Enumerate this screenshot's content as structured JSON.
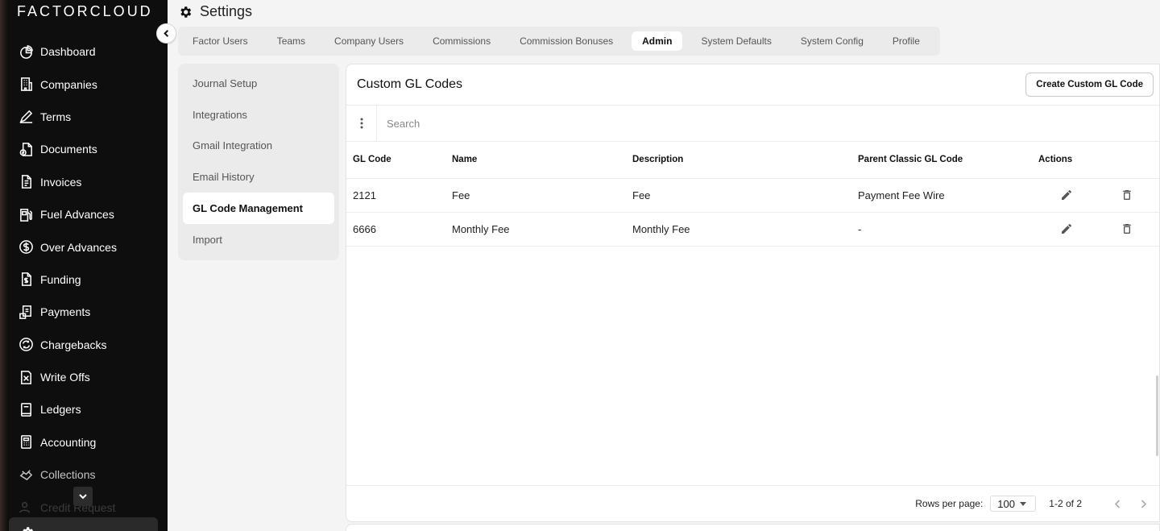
{
  "brand": "FACTORCLOUD",
  "sidebar": {
    "items": [
      {
        "label": "Dashboard",
        "icon": "dashboard-icon"
      },
      {
        "label": "Companies",
        "icon": "building-icon"
      },
      {
        "label": "Terms",
        "icon": "signature-icon"
      },
      {
        "label": "Documents",
        "icon": "documents-icon"
      },
      {
        "label": "Invoices",
        "icon": "invoice-icon"
      },
      {
        "label": "Fuel Advances",
        "icon": "fuel-icon"
      },
      {
        "label": "Over Advances",
        "icon": "dollar-icon"
      },
      {
        "label": "Funding",
        "icon": "funding-icon"
      },
      {
        "label": "Payments",
        "icon": "payments-icon"
      },
      {
        "label": "Chargebacks",
        "icon": "chargeback-icon"
      },
      {
        "label": "Write Offs",
        "icon": "write-off-icon"
      },
      {
        "label": "Ledgers",
        "icon": "ledger-icon"
      },
      {
        "label": "Accounting",
        "icon": "calculator-icon"
      },
      {
        "label": "Collections",
        "icon": "collections-icon"
      },
      {
        "label": "Credit Request",
        "icon": "credit-icon"
      }
    ]
  },
  "header": {
    "title": "Settings",
    "tabs": [
      "Factor Users",
      "Teams",
      "Company Users",
      "Commissions",
      "Commission Bonuses",
      "Admin",
      "System Defaults",
      "System Config",
      "Profile"
    ],
    "active_tab": "Admin"
  },
  "subnav": {
    "items": [
      "Journal Setup",
      "Integrations",
      "Gmail Integration",
      "Email History",
      "GL Code Management",
      "Import"
    ],
    "active": "GL Code Management"
  },
  "card": {
    "title": "Custom GL Codes",
    "create_label": "Create Custom GL Code",
    "search_placeholder": "Search",
    "columns": [
      "GL Code",
      "Name",
      "Description",
      "Parent Classic GL Code",
      "Actions"
    ],
    "rows": [
      {
        "code": "2121",
        "name": "Fee",
        "description": "Fee",
        "parent": "Payment Fee Wire"
      },
      {
        "code": "6666",
        "name": "Monthly Fee",
        "description": "Monthly Fee",
        "parent": "-"
      }
    ],
    "footer": {
      "rows_per_page_label": "Rows per page:",
      "rows_per_page_value": "100",
      "range": "1-2 of 2"
    }
  }
}
